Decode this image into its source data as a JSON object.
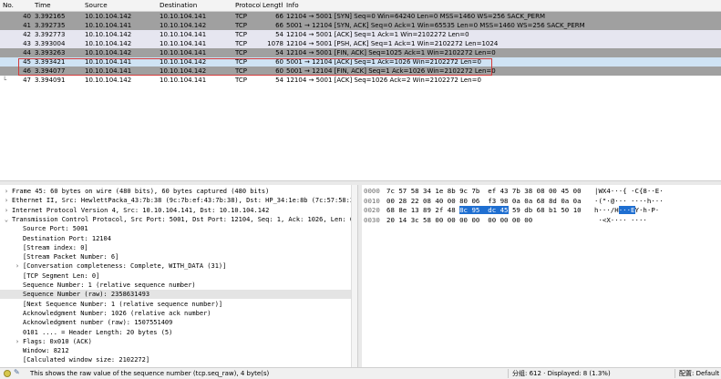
{
  "packet_list": {
    "columns": [
      "No.",
      "Time",
      "Source",
      "Destination",
      "Protocol",
      "Length",
      "Info"
    ],
    "rows": [
      {
        "no": "40",
        "time": "3.392165",
        "src": "10.10.104.142",
        "dst": "10.10.104.141",
        "proto": "TCP",
        "len": "66",
        "info": "12104 → 5001 [SYN] Seq=0 Win=64240 Len=0 MSS=1460 WS=256 SACK_PERM",
        "style": "dark",
        "mark": ""
      },
      {
        "no": "41",
        "time": "3.392735",
        "src": "10.10.104.141",
        "dst": "10.10.104.142",
        "proto": "TCP",
        "len": "66",
        "info": "5001 → 12104 [SYN, ACK] Seq=0 Ack=1 Win=65535 Len=0 MSS=1460 WS=256 SACK_PERM",
        "style": "dark",
        "mark": ""
      },
      {
        "no": "42",
        "time": "3.392773",
        "src": "10.10.104.142",
        "dst": "10.10.104.141",
        "proto": "TCP",
        "len": "54",
        "info": "12104 → 5001 [ACK] Seq=1 Ack=1 Win=2102272 Len=0",
        "style": "light",
        "mark": ""
      },
      {
        "no": "43",
        "time": "3.393004",
        "src": "10.10.104.142",
        "dst": "10.10.104.141",
        "proto": "TCP",
        "len": "1078",
        "info": "12104 → 5001 [PSH, ACK] Seq=1 Ack=1 Win=2102272 Len=1024",
        "style": "light",
        "mark": ""
      },
      {
        "no": "44",
        "time": "3.393263",
        "src": "10.10.104.142",
        "dst": "10.10.104.141",
        "proto": "TCP",
        "len": "54",
        "info": "12104 → 5001 [FIN, ACK] Seq=1025 Ack=1 Win=2102272 Len=0",
        "style": "dark",
        "mark": ""
      },
      {
        "no": "45",
        "time": "3.393421",
        "src": "10.10.104.141",
        "dst": "10.10.104.142",
        "proto": "TCP",
        "len": "60",
        "info": "5001 → 12104 [ACK] Seq=1 Ack=1026 Win=2102272 Len=0",
        "style": "selected",
        "mark": ""
      },
      {
        "no": "46",
        "time": "3.394077",
        "src": "10.10.104.141",
        "dst": "10.10.104.142",
        "proto": "TCP",
        "len": "60",
        "info": "5001 → 12104 [FIN, ACK] Seq=1 Ack=1026 Win=2102272 Len=0",
        "style": "dark",
        "mark": ""
      },
      {
        "no": "47",
        "time": "3.394091",
        "src": "10.10.104.142",
        "dst": "10.10.104.141",
        "proto": "TCP",
        "len": "54",
        "info": "12104 → 5001 [ACK] Seq=1026 Ack=2 Win=2102272 Len=0",
        "style": "white",
        "mark": "└"
      }
    ]
  },
  "details": {
    "rows": [
      {
        "level": 0,
        "arrow": "›",
        "text": "Frame 45: 60 bytes on wire (480 bits), 60 bytes captured (480 bits)",
        "selected": false
      },
      {
        "level": 0,
        "arrow": "›",
        "text": "Ethernet II, Src: HewlettPacka_43:7b:38 (9c:7b:ef:43:7b:38), Dst: HP_34:1e:8b (7c:57:58:34:1e:8",
        "selected": false
      },
      {
        "level": 0,
        "arrow": "›",
        "text": "Internet Protocol Version 4, Src: 10.10.104.141, Dst: 10.10.104.142",
        "selected": false
      },
      {
        "level": 0,
        "arrow": "⌄",
        "text": "Transmission Control Protocol, Src Port: 5001, Dst Port: 12104, Seq: 1, Ack: 1026, Len: 0",
        "selected": false
      },
      {
        "level": 1,
        "arrow": "",
        "text": "Source Port: 5001",
        "selected": false
      },
      {
        "level": 1,
        "arrow": "",
        "text": "Destination Port: 12104",
        "selected": false
      },
      {
        "level": 1,
        "arrow": "",
        "text": "[Stream index: 0]",
        "selected": false
      },
      {
        "level": 1,
        "arrow": "",
        "text": "[Stream Packet Number: 6]",
        "selected": false
      },
      {
        "level": 1,
        "arrow": "›",
        "text": "[Conversation completeness: Complete, WITH_DATA (31)]",
        "selected": false
      },
      {
        "level": 1,
        "arrow": "",
        "text": "[TCP Segment Len: 0]",
        "selected": false
      },
      {
        "level": 1,
        "arrow": "",
        "text": "Sequence Number: 1    (relative sequence number)",
        "selected": false
      },
      {
        "level": 1,
        "arrow": "",
        "text": "Sequence Number (raw): 2358631493",
        "selected": true
      },
      {
        "level": 1,
        "arrow": "",
        "text": "[Next Sequence Number: 1    (relative sequence number)]",
        "selected": false
      },
      {
        "level": 1,
        "arrow": "",
        "text": "Acknowledgment Number: 1026    (relative ack number)",
        "selected": false
      },
      {
        "level": 1,
        "arrow": "",
        "text": "Acknowledgment number (raw): 1507551409",
        "selected": false
      },
      {
        "level": 1,
        "arrow": "",
        "text": "0101 .... = Header Length: 20 bytes (5)",
        "selected": false
      },
      {
        "level": 1,
        "arrow": "›",
        "text": "Flags: 0x010 (ACK)",
        "selected": false
      },
      {
        "level": 1,
        "arrow": "",
        "text": "Window: 8212",
        "selected": false
      },
      {
        "level": 1,
        "arrow": "",
        "text": "[Calculated window size: 2102272]",
        "selected": false
      }
    ]
  },
  "bytes": {
    "rows": [
      {
        "offset": "0000",
        "hex_pre": "7c 57 58 34 1e 8b 9c 7b  ef 43 7b 38 08 00 45 00",
        "hex_hl": "",
        "hex_post": "",
        "ascii_pre": "|WX4···{ ·C{8··E·",
        "ascii_hl": "",
        "ascii_post": ""
      },
      {
        "offset": "0010",
        "hex_pre": "00 28 22 08 40 00 80 06  f3 98 0a 0a 68 8d 0a 0a",
        "hex_hl": "",
        "hex_post": "",
        "ascii_pre": "·(\"·@··· ····h···",
        "ascii_hl": "",
        "ascii_post": ""
      },
      {
        "offset": "0020",
        "hex_pre": "68 8e 13 89 2f 48 ",
        "hex_hl": "8c 95  dc 45",
        "hex_post": " 59 db 68 b1 50 10",
        "ascii_pre": "h···/H",
        "ascii_hl": "···E",
        "ascii_post": "Y·h·P·"
      },
      {
        "offset": "0030",
        "hex_pre": "20 14 3c 58 00 00 00 00  00 00 00 00",
        "hex_hl": "",
        "hex_post": "",
        "ascii_pre": " ·<X···· ····",
        "ascii_hl": "",
        "ascii_post": ""
      }
    ]
  },
  "statusbar": {
    "message": "This shows the raw value of the sequence number (tcp.seq_raw), 4 byte(s)",
    "packets": "分组: 612 · Displayed: 8 (1.3%)",
    "profile": "配置: Default"
  },
  "colors": {
    "row_dark": "#a0a0a0",
    "row_light": "#e6e6f0",
    "selected": "#cfe3f4",
    "highlight_border": "#d33a3a",
    "byte_highlight": "#1f6fd1"
  }
}
